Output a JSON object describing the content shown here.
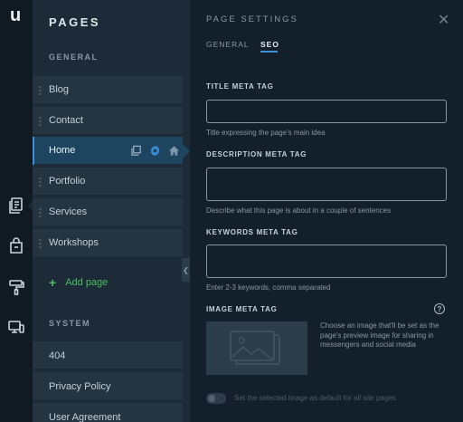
{
  "app": {
    "logo": "u"
  },
  "rail": {
    "icons": [
      "pages-icon",
      "store-icon",
      "design-icon",
      "devices-icon"
    ]
  },
  "pages_panel": {
    "title": "PAGES",
    "general_label": "GENERAL",
    "items": [
      {
        "label": "Blog"
      },
      {
        "label": "Contact"
      },
      {
        "label": "Home",
        "active": true
      },
      {
        "label": "Portfolio"
      },
      {
        "label": "Services"
      },
      {
        "label": "Workshops"
      }
    ],
    "add_page": "Add page",
    "system_label": "SYSTEM",
    "system_items": [
      {
        "label": "404"
      },
      {
        "label": "Privacy Policy"
      },
      {
        "label": "User Agreement"
      }
    ]
  },
  "settings": {
    "title": "PAGE SETTINGS",
    "tabs": {
      "general": "GENERAL",
      "seo": "SEO"
    },
    "active_tab": "SEO",
    "title_meta": {
      "label": "TITLE META TAG",
      "value": "",
      "hint": "Title expressing the page's main idea"
    },
    "description_meta": {
      "label": "DESCRIPTION META TAG",
      "value": "",
      "hint": "Describe what this page is about in a couple of sentences"
    },
    "keywords_meta": {
      "label": "KEYWORDS META TAG",
      "value": "",
      "hint": "Enter 2-3 keywords, comma separated"
    },
    "image_meta": {
      "label": "IMAGE META TAG",
      "help": "?",
      "description": "Choose an image that'll be set as the page's preview image for sharing in messengers and social media"
    },
    "default_toggle": {
      "label": "Set the selected image as default for all site pages",
      "on": false
    }
  },
  "colors": {
    "accent": "#3d8fd6",
    "add_green": "#4cbf63",
    "panel": "#1c2b37",
    "background": "#13202b"
  }
}
